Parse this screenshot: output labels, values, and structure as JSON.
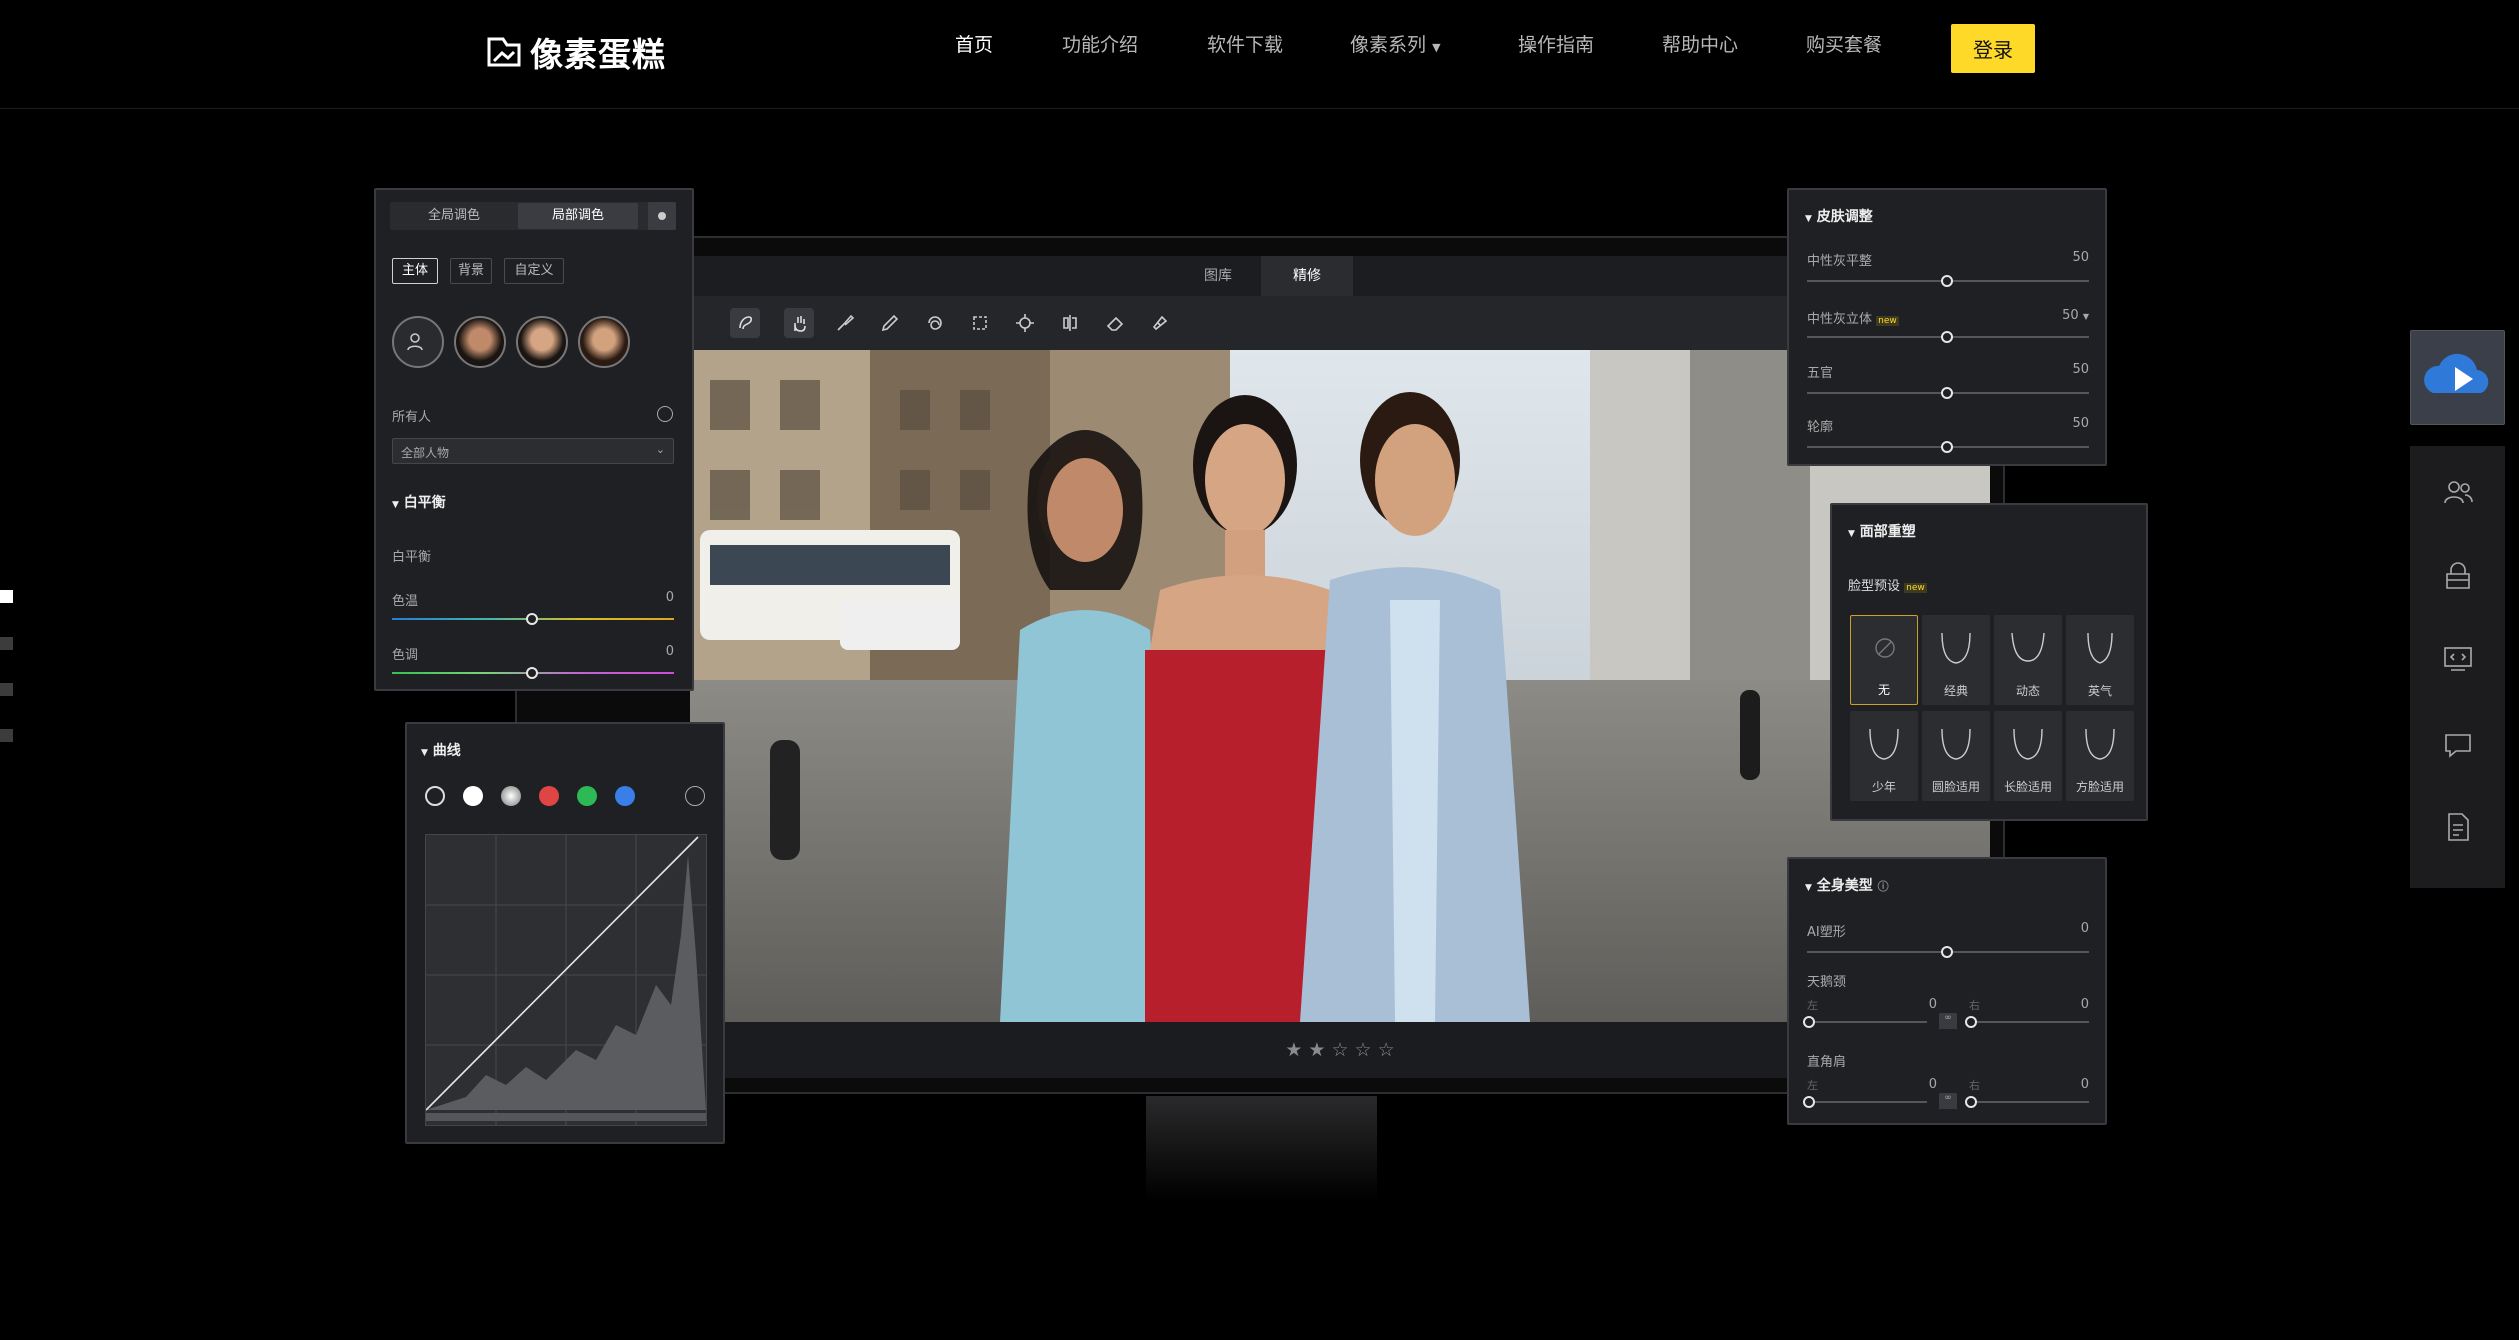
{
  "brand": {
    "logo_text": "像素蛋糕",
    "accent": "#ffd928"
  },
  "nav": {
    "items": [
      "首页",
      "功能介绍",
      "软件下载",
      "像素系列",
      "操作指南",
      "帮助中心",
      "购买套餐"
    ],
    "login": "登录"
  },
  "app": {
    "tabs": [
      "图库",
      "精修"
    ],
    "rating_stars": [
      "★",
      "★",
      "☆",
      "☆",
      "☆"
    ]
  },
  "local_panel": {
    "tabs": [
      "全局调色",
      "局部调色"
    ],
    "chips": [
      "主体",
      "背景",
      "自定义"
    ],
    "people_label": "所有人",
    "people_select": "全部人物",
    "wb_title": "白平衡",
    "wb_sub": "白平衡",
    "temp_label": "色温",
    "temp_value": "0",
    "tint_label": "色调",
    "tint_value": "0"
  },
  "curve_panel": {
    "title": "曲线"
  },
  "skin_panel": {
    "title": "皮肤调整",
    "rows": [
      {
        "label": "中性灰平整",
        "value": "50"
      },
      {
        "label": "中性灰立体",
        "value": "50"
      },
      {
        "label": "五官",
        "value": "50"
      },
      {
        "label": "轮廓",
        "value": "50"
      }
    ],
    "badge": "new"
  },
  "face_panel": {
    "title": "面部重塑",
    "preset_label": "脸型预设",
    "badge": "new",
    "presets": [
      "无",
      "经典",
      "动态",
      "英气",
      "少年",
      "圆脸适用",
      "长脸适用",
      "方脸适用"
    ]
  },
  "body_panel": {
    "title": "全身美型",
    "ai_label": "AI塑形",
    "ai_value": "0",
    "swan_label": "天鹅颈",
    "square_label": "直角肩",
    "left": "左",
    "right": "右",
    "zero": "0"
  }
}
